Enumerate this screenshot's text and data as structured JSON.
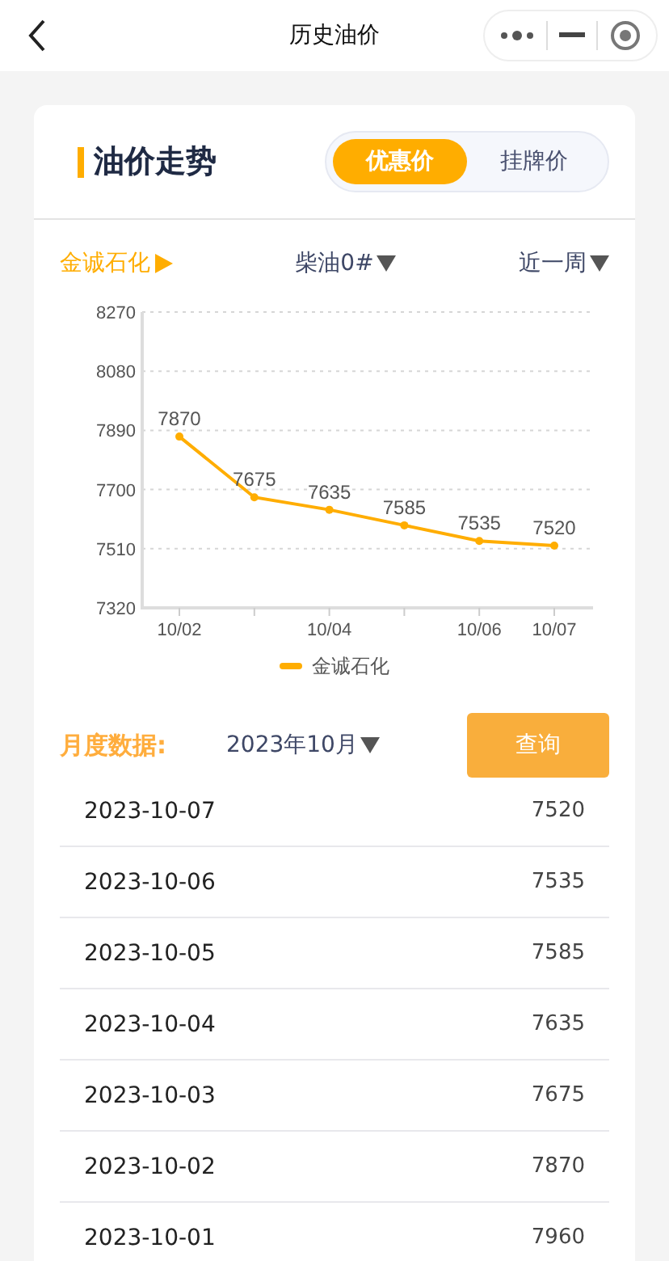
{
  "nav": {
    "title": "历史油价"
  },
  "card": {
    "title": "油价走势",
    "tabs": [
      {
        "label": "优惠价",
        "selected": true
      },
      {
        "label": "挂牌价",
        "selected": false
      }
    ]
  },
  "filters": [
    {
      "label": "金诚石化",
      "kind": "link"
    },
    {
      "label": "柴油0#",
      "kind": "dropdown"
    },
    {
      "label": "近一周",
      "kind": "dropdown"
    }
  ],
  "chart_data": {
    "type": "line",
    "categories": [
      "10/02",
      null,
      "10/04",
      null,
      "10/06",
      "10/07"
    ],
    "series": [
      {
        "name": "金诚石化",
        "color": "#ffad00",
        "marker": "circle",
        "values": [
          7870,
          7675,
          7635,
          7585,
          7535,
          7520
        ]
      }
    ],
    "grid": "y",
    "ylim": [
      7320,
      8270
    ],
    "yticks": [
      7320,
      7510,
      7700,
      7890,
      8080,
      8270
    ],
    "data_labels": true
  },
  "monthly": {
    "label": "月度数据:",
    "month": "2023年10月",
    "button": "查询"
  },
  "rows": [
    {
      "date": "2023-10-07",
      "price": "7520"
    },
    {
      "date": "2023-10-06",
      "price": "7535"
    },
    {
      "date": "2023-10-05",
      "price": "7585"
    },
    {
      "date": "2023-10-04",
      "price": "7635"
    },
    {
      "date": "2023-10-03",
      "price": "7675"
    },
    {
      "date": "2023-10-02",
      "price": "7870"
    },
    {
      "date": "2023-10-01",
      "price": "7960"
    }
  ]
}
